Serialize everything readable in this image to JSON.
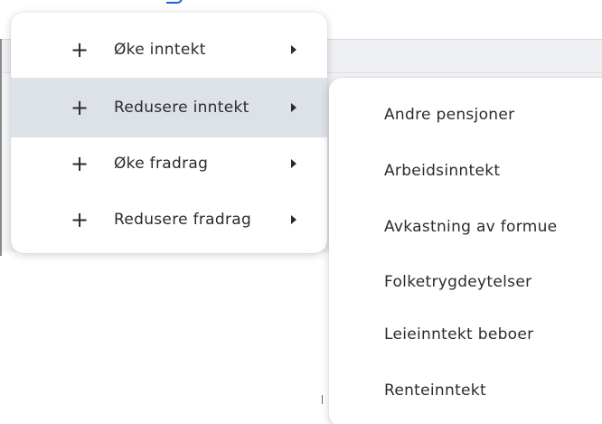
{
  "menu": {
    "items": [
      {
        "icon": "plus-icon",
        "label": "Øke inntekt",
        "active": false,
        "has_submenu": true
      },
      {
        "icon": "plus-icon",
        "label": "Redusere inntekt",
        "active": true,
        "has_submenu": true
      },
      {
        "icon": "plus-icon",
        "label": "Øke fradrag",
        "active": false,
        "has_submenu": true
      },
      {
        "icon": "plus-icon",
        "label": "Redusere fradrag",
        "active": false,
        "has_submenu": true
      }
    ]
  },
  "submenu": {
    "items": [
      {
        "label": "Andre pensjoner"
      },
      {
        "label": "Arbeidsinntekt"
      },
      {
        "label": "Avkastning av formue"
      },
      {
        "label": "Folketrygdeytelser"
      },
      {
        "label": "Leieinntekt beboer"
      },
      {
        "label": "Renteinntekt"
      }
    ]
  },
  "colors": {
    "active_row": "#dde1e8",
    "text": "#2b2b2b",
    "link": "#1a63d6"
  }
}
